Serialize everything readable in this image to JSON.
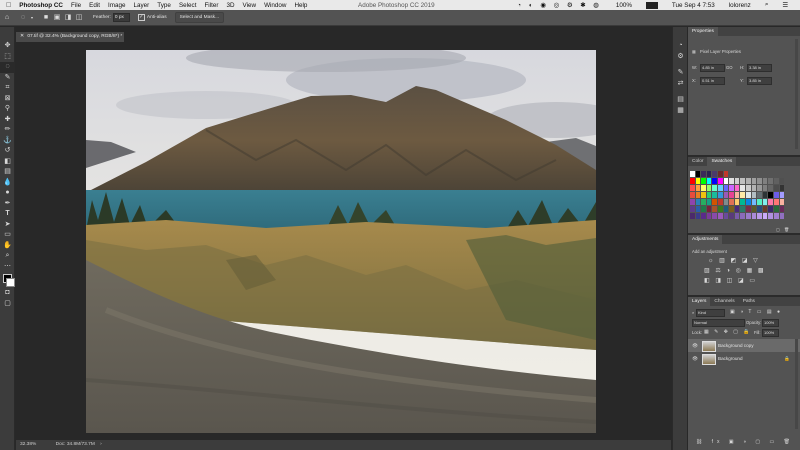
{
  "menubar": {
    "apple": "",
    "items": [
      "Photoshop CC",
      "File",
      "Edit",
      "Image",
      "Layer",
      "Type",
      "Select",
      "Filter",
      "3D",
      "View",
      "Window",
      "Help"
    ],
    "window_title": "Adobe Photoshop CC 2019",
    "battery": "100%",
    "clock": "Tue Sep 4  7:53",
    "user": "lolorenz"
  },
  "options_bar": {
    "feather_label": "Feather:",
    "feather_value": "0 px",
    "antialias_label": "Anti-alias",
    "select_mask_label": "Select and Mask..."
  },
  "document": {
    "tab_title": "07.tif @ 32.4% (Background copy, RGB/8*) *",
    "zoom": "32.38%",
    "doc_size": "Doc: 34.8M/73.7M"
  },
  "properties": {
    "tab": "Properties",
    "type_label": "Pixel Layer Properties",
    "w_label": "W:",
    "w_value": "4.85 in",
    "h_label": "H:",
    "h_value": "3.38 in",
    "go_label": "GO",
    "x_label": "X:",
    "x_value": "0.51 in",
    "y_label": "Y:",
    "y_value": "3.85 in"
  },
  "color_panel": {
    "tabs": [
      "Color",
      "Swatches"
    ],
    "active": "Swatches"
  },
  "adjustments": {
    "tab": "Adjustments",
    "hint": "Add an adjustment"
  },
  "layers_panel": {
    "tabs": [
      "Layers",
      "Channels",
      "Paths"
    ],
    "filter": "Kind",
    "blend_mode": "Normal",
    "opacity_label": "Opacity:",
    "opacity_value": "100%",
    "lock_label": "Lock:",
    "fill_label": "Fill:",
    "fill_value": "100%",
    "layers": [
      {
        "name": "Background copy",
        "selected": true
      },
      {
        "name": "Background",
        "selected": false
      }
    ]
  },
  "colors": {
    "accent": "#1473e6",
    "panel": "#535353",
    "dark": "#282828"
  }
}
